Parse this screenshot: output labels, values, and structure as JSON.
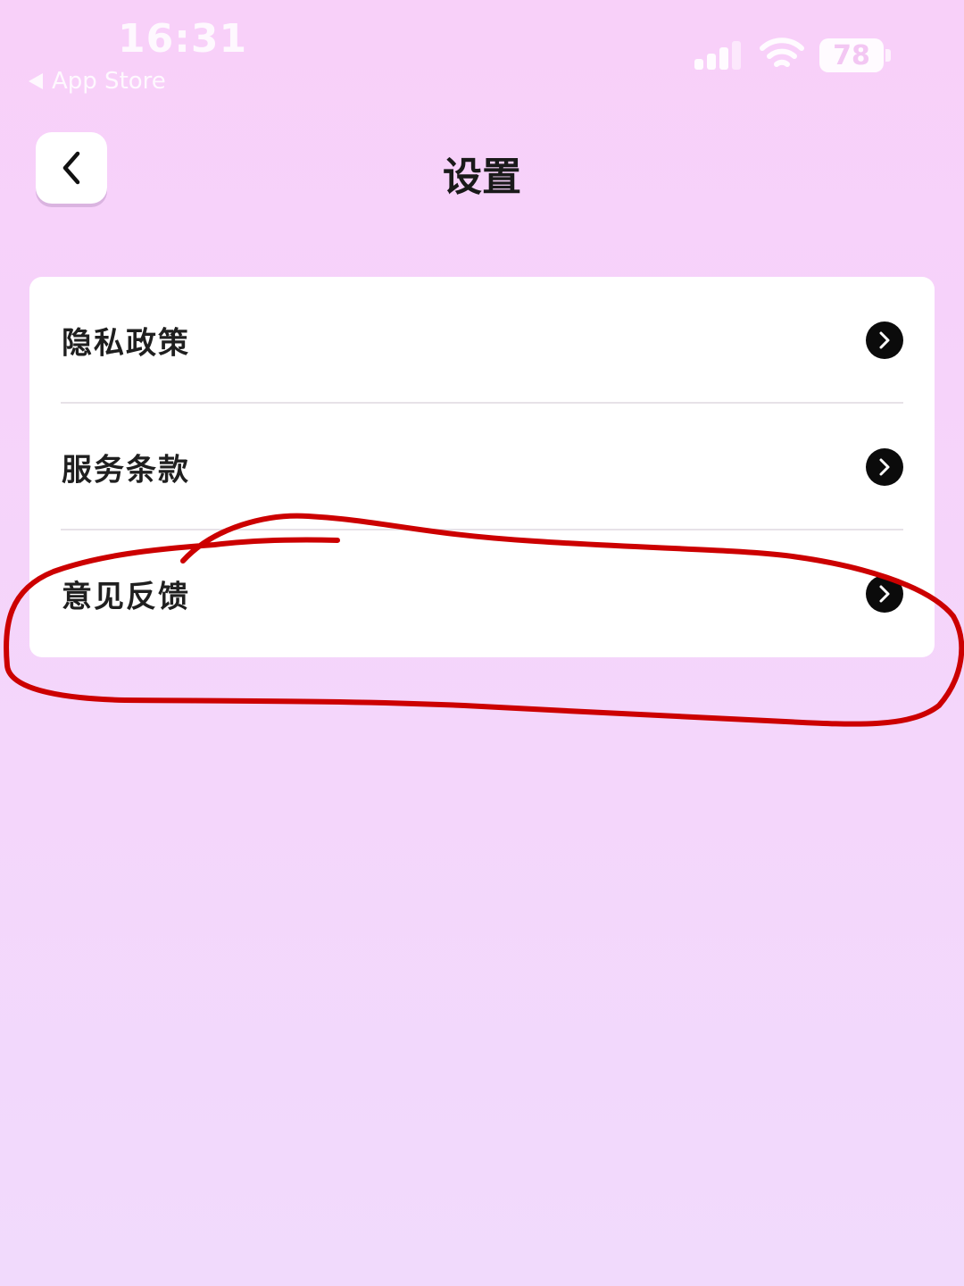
{
  "status_bar": {
    "time": "16:31",
    "back_app": "App Store",
    "battery": "78",
    "icons": [
      "signal-icon",
      "wifi-icon",
      "battery-icon"
    ]
  },
  "nav": {
    "title": "设置",
    "back_icon": "chevron-left-icon"
  },
  "settings": {
    "items": [
      {
        "label": "隐私政策",
        "icon": "chevron-right-icon"
      },
      {
        "label": "服务条款",
        "icon": "chevron-right-icon"
      },
      {
        "label": "意见反馈",
        "icon": "chevron-right-icon"
      }
    ]
  },
  "annotation": {
    "color": "#cc0000",
    "shape": "hand-drawn-ellipse",
    "target": "意见反馈"
  },
  "colors": {
    "background": "#f6d3fa",
    "card": "#ffffff",
    "accent": "#0b0b0b"
  }
}
